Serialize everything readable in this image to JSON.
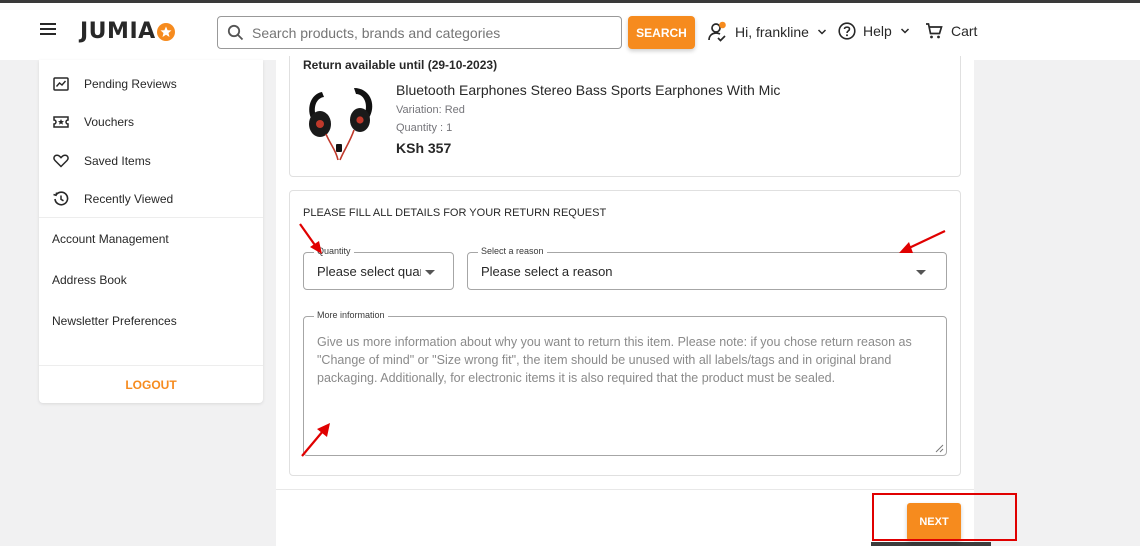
{
  "header": {
    "logo_text": "JUMIA",
    "search_placeholder": "Search products, brands and categories",
    "search_button": "SEARCH",
    "account_label": "Hi, frankline",
    "help_label": "Help",
    "cart_label": "Cart"
  },
  "sidebar": {
    "items": [
      {
        "label": "Pending Reviews",
        "icon": "review-icon"
      },
      {
        "label": "Vouchers",
        "icon": "voucher-icon"
      },
      {
        "label": "Saved Items",
        "icon": "heart-icon"
      },
      {
        "label": "Recently Viewed",
        "icon": "history-icon"
      }
    ],
    "links": [
      "Account Management",
      "Address Book",
      "Newsletter Preferences"
    ],
    "logout": "LOGOUT"
  },
  "product": {
    "return_until": "Return available until (29-10-2023)",
    "title": "Bluetooth Earphones Stereo Bass Sports Earphones With Mic",
    "variation": "Variation: Red",
    "quantity": "Quantity : 1",
    "price": "KSh 357"
  },
  "form": {
    "title": "PLEASE FILL ALL DETAILS FOR YOUR RETURN REQUEST",
    "quantity_label": "Quantity",
    "quantity_value": "Please select quantity",
    "reason_label": "Select a reason",
    "reason_value": "Please select a reason",
    "info_label": "More information",
    "info_placeholder": "Give us more information about why you want to return this item. Please note: if you chose return reason as \"Change of mind\" or \"Size wrong fit\", the item should be unused with all labels/tags and in original brand packaging. Additionally, for electronic items it is also required that the product must be sealed."
  },
  "actions": {
    "next": "NEXT"
  },
  "colors": {
    "brand_orange": "#f68b1e",
    "annotation_red": "#e00000"
  }
}
